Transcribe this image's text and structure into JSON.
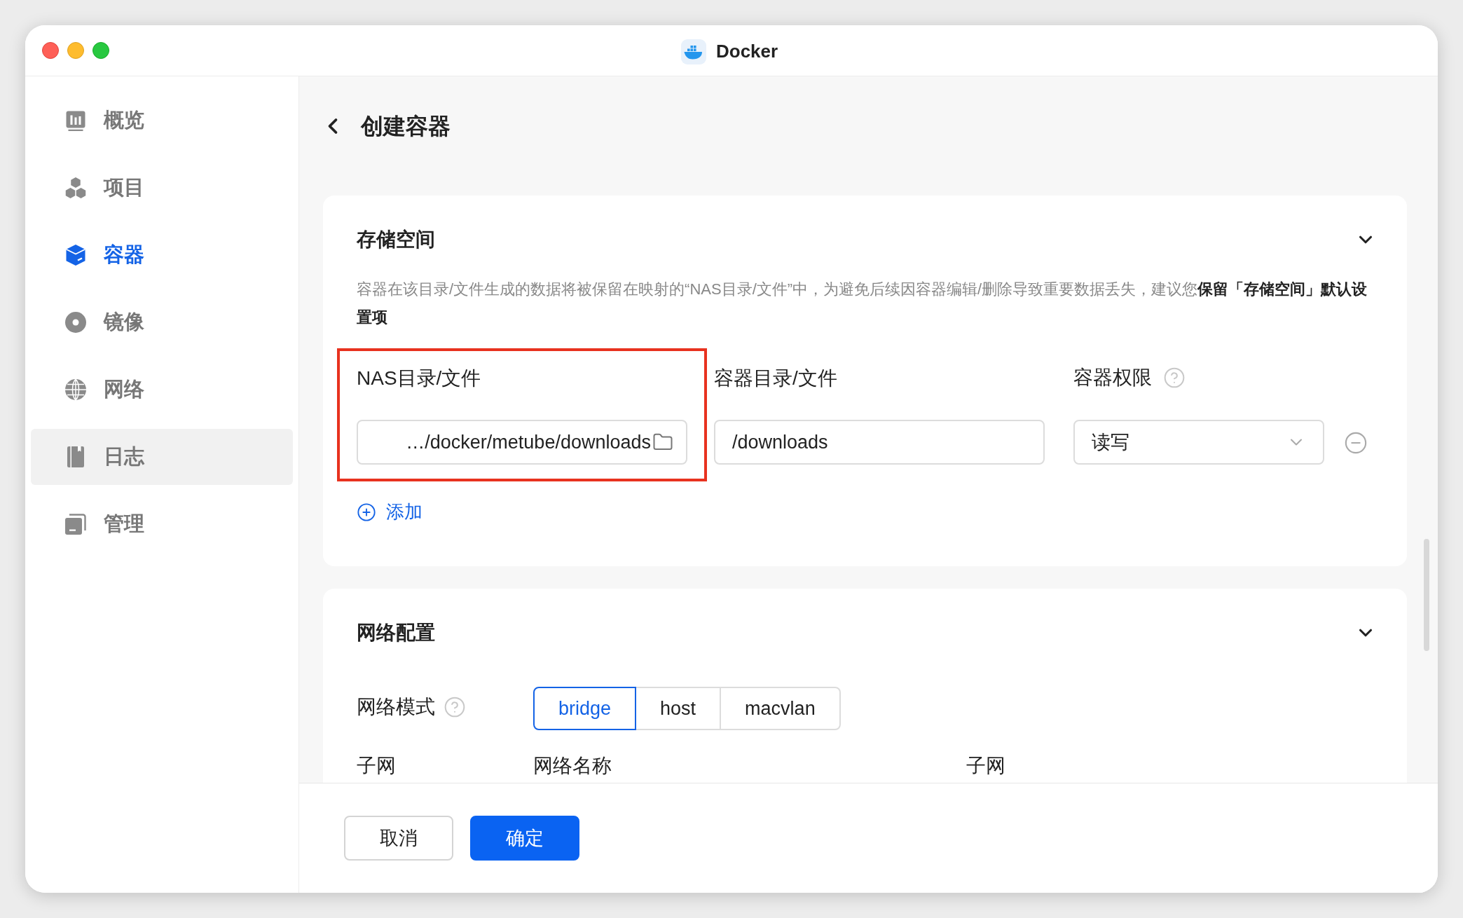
{
  "window": {
    "title": "Docker"
  },
  "sidebar": {
    "items": [
      {
        "label": "概览",
        "selected": false,
        "hovered": false
      },
      {
        "label": "项目",
        "selected": false,
        "hovered": false
      },
      {
        "label": "容器",
        "selected": true,
        "hovered": false
      },
      {
        "label": "镜像",
        "selected": false,
        "hovered": false
      },
      {
        "label": "网络",
        "selected": false,
        "hovered": false
      },
      {
        "label": "日志",
        "selected": false,
        "hovered": true
      },
      {
        "label": "管理",
        "selected": false,
        "hovered": false
      }
    ]
  },
  "page": {
    "title": "创建容器"
  },
  "storage": {
    "title": "存储空间",
    "expanded": true,
    "description": "容器在该目录/文件生成的数据将被保留在映射的“NAS目录/文件”中，为避免后续因容器编辑/删除导致重要数据丢失，建议您**保留「存储空间」默认设置项**",
    "columns": [
      "NAS目录/文件",
      "容器目录/文件",
      "容器权限"
    ],
    "mappings": [
      {
        "nas_path": "…/docker/metube/downloads",
        "container_path": "/downloads",
        "permission": "读写",
        "highlighted": true
      }
    ],
    "add_label": "添加"
  },
  "network": {
    "title": "网络配置",
    "expanded": true,
    "mode_label": "网络模式",
    "modes": [
      {
        "label": "bridge",
        "selected": true
      },
      {
        "label": "host",
        "selected": false
      },
      {
        "label": "macvlan",
        "selected": false
      }
    ],
    "columns": [
      "子网",
      "网络名称",
      "子网"
    ]
  },
  "footer": {
    "buttons": [
      {
        "label": "取消",
        "kind": "secondary"
      },
      {
        "label": "确定",
        "kind": "primary"
      }
    ]
  }
}
